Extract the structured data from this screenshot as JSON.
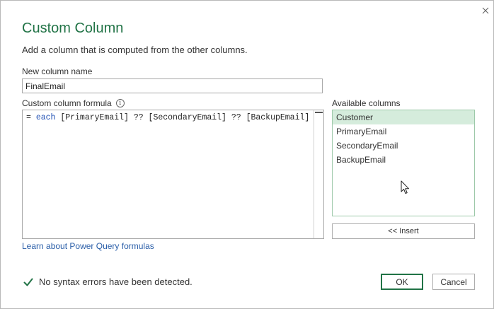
{
  "dialog": {
    "title": "Custom Column",
    "subtitle": "Add a column that is computed from the other columns.",
    "close_icon": "close-icon"
  },
  "new_column": {
    "label": "New column name",
    "value": "FinalEmail"
  },
  "formula": {
    "label": "Custom column formula",
    "info_icon": "info-icon",
    "prefix": "= ",
    "keyword": "each",
    "expression": " [PrimaryEmail] ?? [SecondaryEmail] ?? [BackupEmail]"
  },
  "available_columns": {
    "label": "Available columns",
    "items": [
      {
        "label": "Customer",
        "selected": true
      },
      {
        "label": "PrimaryEmail",
        "selected": false
      },
      {
        "label": "SecondaryEmail",
        "selected": false
      },
      {
        "label": "BackupEmail",
        "selected": false
      }
    ],
    "insert_label": "<< Insert"
  },
  "learn_link": "Learn about Power Query formulas",
  "status": {
    "icon": "check-icon",
    "text": "No syntax errors have been detected."
  },
  "buttons": {
    "ok": "OK",
    "cancel": "Cancel"
  },
  "colors": {
    "accent": "#217346",
    "link": "#2a5ea8",
    "selected_row": "#d5ecdc",
    "keyword": "#1f4fb4"
  }
}
